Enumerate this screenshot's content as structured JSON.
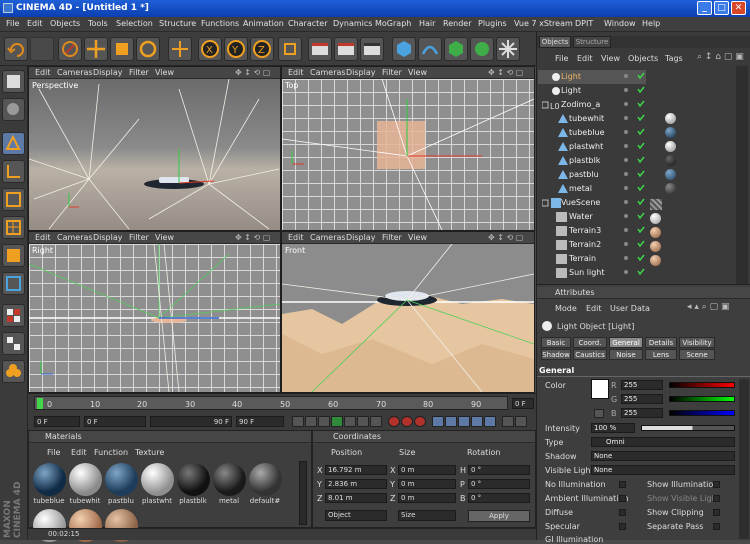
{
  "window": {
    "title": "CINEMA 4D - [Untitled 1 *]"
  },
  "menu": [
    "File",
    "Edit",
    "Objects",
    "Tools",
    "Selection",
    "Structure",
    "Functions",
    "Animation",
    "Character",
    "Dynamics",
    "MoGraph",
    "Hair",
    "Render",
    "Plugins",
    "Vue 7 xStream",
    "DPIT",
    "Window",
    "Help"
  ],
  "viewports": [
    {
      "label": "Perspective",
      "menu": [
        "Edit",
        "Cameras",
        "Display",
        "Filter",
        "View"
      ]
    },
    {
      "label": "Top",
      "menu": [
        "Edit",
        "Cameras",
        "Display",
        "Filter",
        "View"
      ]
    },
    {
      "label": "Right",
      "menu": [
        "Edit",
        "Cameras",
        "Display",
        "Filter",
        "View"
      ]
    },
    {
      "label": "Front",
      "menu": [
        "Edit",
        "Cameras",
        "Display",
        "Filter",
        "View"
      ]
    }
  ],
  "axis": {
    "y": "Y",
    "z": "Z",
    "x": "X"
  },
  "timeline": {
    "ticks": [
      "0",
      "10",
      "20",
      "30",
      "40",
      "50",
      "60",
      "70",
      "80",
      "90"
    ],
    "frame_right": "0 F",
    "start": "0 F",
    "range_start": "0 F",
    "range_end": "90 F",
    "end": "90 F"
  },
  "materials": {
    "title": "Materials",
    "menu": [
      "File",
      "Edit",
      "Function",
      "Texture"
    ],
    "items": [
      {
        "name": "tubeblue",
        "color": "#0f2b45"
      },
      {
        "name": "tubewhit",
        "color": "#cfcfcf"
      },
      {
        "name": "pastblu",
        "color": "#1e3d5a"
      },
      {
        "name": "plastwht",
        "color": "#d4d4d4"
      },
      {
        "name": "plastblk",
        "color": "#141414"
      },
      {
        "name": "metal",
        "color": "#2a2a2a"
      },
      {
        "name": "default#",
        "color": "#5a5a5a"
      }
    ]
  },
  "coordinates": {
    "title": "Coordinates",
    "headers": [
      "Position",
      "Size",
      "Rotation"
    ],
    "rows": [
      {
        "axis": "X",
        "pos": "16.792 m",
        "size": "0 m",
        "rlabel": "H",
        "rot": "0 °"
      },
      {
        "axis": "Y",
        "pos": "2.836 m",
        "size": "0 m",
        "rlabel": "P",
        "rot": "0 °"
      },
      {
        "axis": "Z",
        "pos": "8.01 m",
        "size": "0 m",
        "rlabel": "B",
        "rot": "0 °"
      }
    ],
    "mode1": "Object",
    "mode2": "Size",
    "apply": "Apply"
  },
  "status": {
    "time": "00:02:15"
  },
  "object_manager": {
    "tabs": [
      "Objects",
      "Structure"
    ],
    "menu": [
      "File",
      "Edit",
      "View",
      "Objects",
      "Tags"
    ],
    "items": [
      {
        "name": "Light",
        "indent": 0
      },
      {
        "name": "Light",
        "indent": 0
      },
      {
        "name": "Zodimo_a",
        "indent": 0
      },
      {
        "name": "tubewhit",
        "indent": 1
      },
      {
        "name": "tubeblue",
        "indent": 1
      },
      {
        "name": "plastwht",
        "indent": 1
      },
      {
        "name": "plastblk",
        "indent": 1
      },
      {
        "name": "pastblu",
        "indent": 1
      },
      {
        "name": "metal",
        "indent": 1
      },
      {
        "name": "VueScene",
        "indent": 0
      },
      {
        "name": "Water",
        "indent": 1
      },
      {
        "name": "Terrain3",
        "indent": 1
      },
      {
        "name": "Terrain2",
        "indent": 1
      },
      {
        "name": "Terrain",
        "indent": 1
      },
      {
        "name": "Sun light",
        "indent": 1
      }
    ]
  },
  "attributes": {
    "title": "Attributes",
    "menu": [
      "Mode",
      "Edit",
      "User Data"
    ],
    "object": "Light Object [Light]",
    "tabs_row1": [
      "Basic",
      "Coord.",
      "General",
      "Details",
      "Visibility"
    ],
    "tabs_row2": [
      "Shadow",
      "Caustics",
      "Noise",
      "Lens",
      "Scene"
    ],
    "section": "General",
    "color_label": "Color",
    "r": "255",
    "g": "255",
    "b": "255",
    "intensity_label": "Intensity",
    "intensity": "100 %",
    "type_label": "Type",
    "type": "Omni",
    "shadow_label": "Shadow",
    "shadow": "None",
    "visible_label": "Visible Light",
    "visible": "None",
    "checks_left": [
      "No Illumination",
      "Ambient Illumination",
      "Diffuse",
      "Specular",
      "GI Illumination"
    ],
    "checks_right": [
      "Show Illumination",
      "Show Visible Light",
      "Show Clipping",
      "Separate Pass"
    ]
  },
  "logo": "MAXON CINEMA 4D"
}
